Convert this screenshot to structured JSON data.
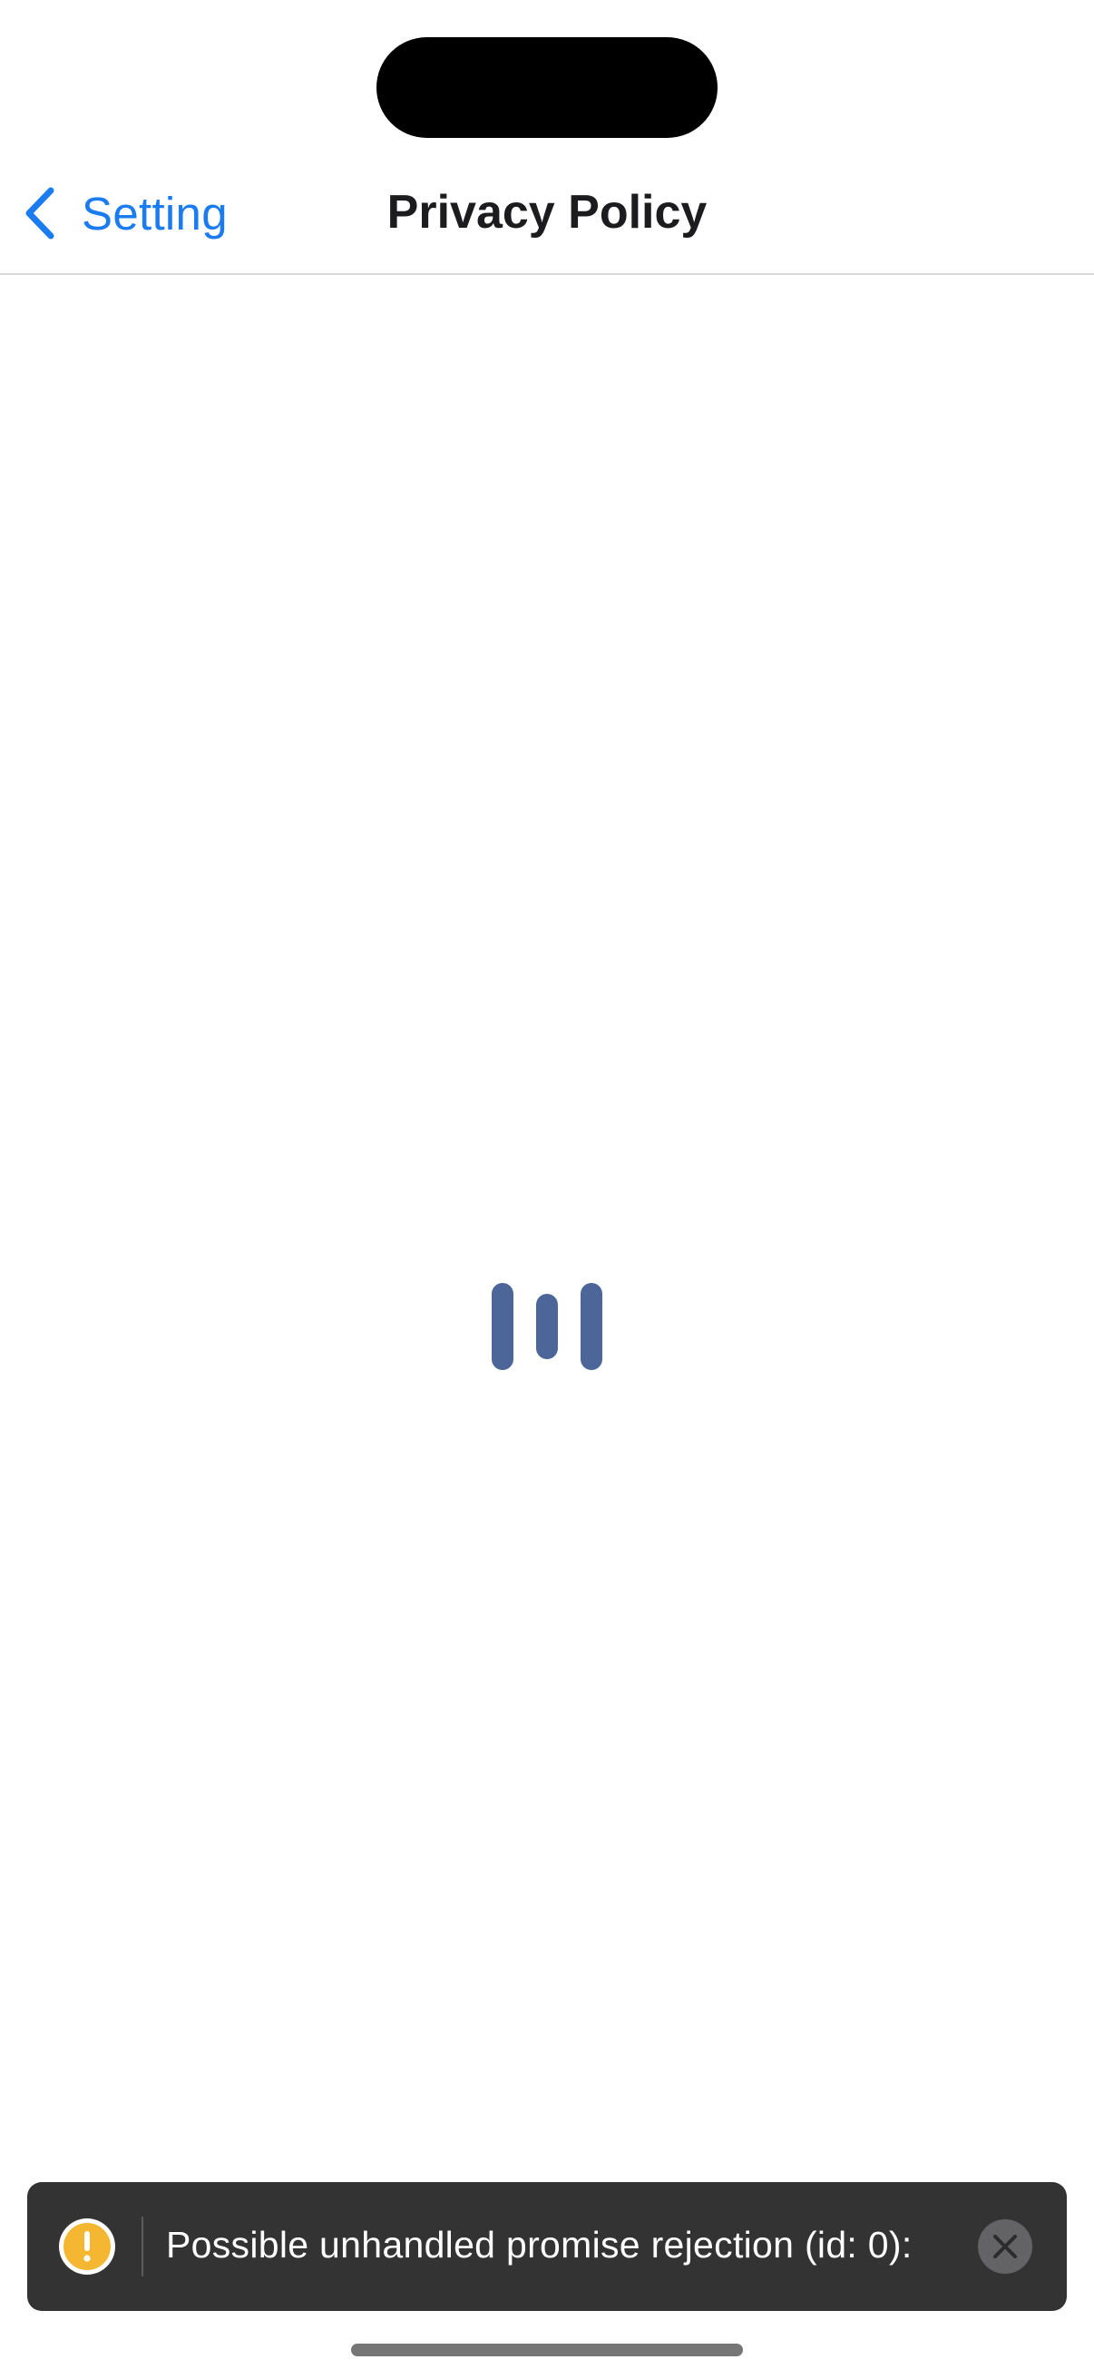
{
  "navbar": {
    "back_label": "Setting",
    "title": "Privacy Policy"
  },
  "loader": {
    "icon": "loading-bars-icon",
    "color": "#4d6699"
  },
  "toast": {
    "message": "Possible unhandled promise rejection (id: 0):",
    "icon": "warning-icon",
    "icon_color": "#f5b731",
    "close_icon": "close-icon"
  },
  "colors": {
    "accent": "#1a7cf0",
    "toast_background": "#333333"
  }
}
